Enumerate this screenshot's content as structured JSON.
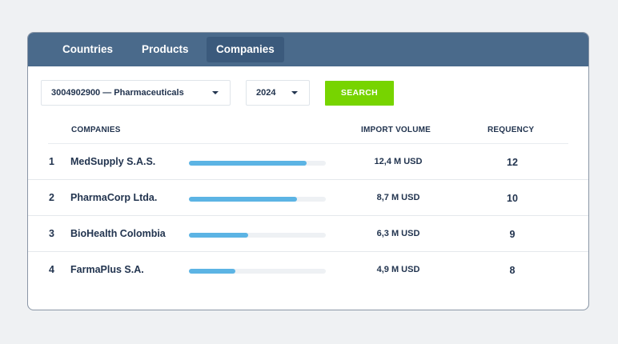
{
  "tabs": [
    {
      "label": "Countries",
      "active": false
    },
    {
      "label": "Products",
      "active": false
    },
    {
      "label": "Companies",
      "active": true
    }
  ],
  "filters": {
    "product": "3004902900 — Pharmaceuticals",
    "year": "2024",
    "search_label": "SEARCH"
  },
  "table": {
    "headers": {
      "companies": "COMPANIES",
      "import_volume": "IMPORT VOLUME",
      "frequency": "REQUENCY"
    },
    "rows": [
      {
        "rank": "1",
        "name": "MedSupply S.A.S.",
        "share": 0.86,
        "volume": "12,4 M USD",
        "frequency": "12"
      },
      {
        "rank": "2",
        "name": "PharmaCorp Ltda.",
        "share": 0.79,
        "volume": "8,7 M USD",
        "frequency": "10"
      },
      {
        "rank": "3",
        "name": "BioHealth Colombia",
        "share": 0.43,
        "volume": "6,3 M USD",
        "frequency": "9"
      },
      {
        "rank": "4",
        "name": "FarmaPlus S.A.",
        "share": 0.34,
        "volume": "4,9 M USD",
        "frequency": "8"
      }
    ]
  },
  "colors": {
    "header_bg": "#4a6a8b",
    "active_tab_bg": "#3b5a7c",
    "search_button": "#77d400",
    "bar_fill": "#5cb4e4",
    "bar_track": "#eef1f4"
  },
  "icons": {
    "dropdown": "caret-down-icon"
  }
}
